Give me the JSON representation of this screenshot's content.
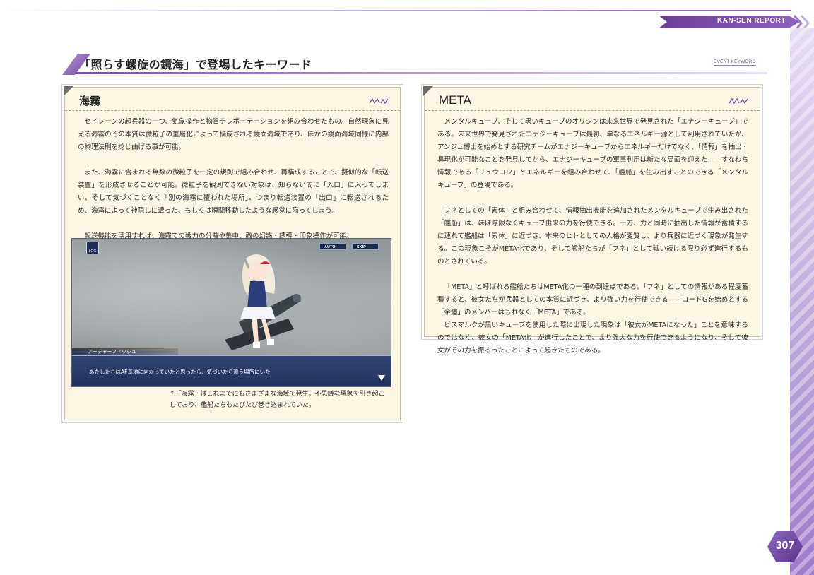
{
  "header": {
    "report_label": "KAN-SEN REPORT"
  },
  "page_title": "「照らす螺旋の鏡海」で登場したキーワード",
  "event_keyword": "EVENT KEYWORD",
  "left_box": {
    "heading": "海霧",
    "paragraphs": [
      "セイレーンの超兵器の一つ、気象操作と物質テレポーテーションを組み合わせたもの。自然現象に見える海霧のその本質は微粒子の重層化によって構成される鏡面海域であり、ほかの鏡面海域同様に内部の物理法則を捻じ曲げる事が可能。",
      "また、海霧に含まれる無数の微粒子を一定の規則で組み合わせ、再構成することで、擬似的な「転送装置」を形成させることが可能。微粒子を観測できない対象は、知らない間に「入口」に入ってしまい、そして気づくことなく「別の海霧に覆われた場所」、つまり転送装置の「出口」に転送されるため、海霧によって神隠しに遭った、もしくは瞬間移動したような感覚に陥ってしまう。",
      "転送機能を活用すれば、海霧での戦力の分散や集中、敵の幻惑・誘導・印象操作が可能。"
    ],
    "game": {
      "log_label": "LOG",
      "auto_label": "AUTO",
      "skip_label": "SKIP",
      "speaker": "アーチャーフィッシュ",
      "line": "あたしたちはAF基地に向かっていたと思ったら、気づいたら違う場所にいた",
      "next_label": "NEXT"
    },
    "caption": "↑「海霧」はこれまでにもさまざまな海域で発生。不思議な現象を引き起こしており、艦船たちもたびたび巻き込まれていた。"
  },
  "right_box": {
    "heading": "META",
    "paragraphs": [
      "メンタルキューブ、そして黒いキューブのオリジンは未来世界で発見された「エナジーキューブ」である。未来世界で発見されたエナジーキューブは最初、単なるエネルギー源として利用されていたが、アンジュ博士を始めとする研究チームがエナジーキューブからエネルギーだけでなく、「情報」を抽出・具現化が可能なことを発見してから、エナジーキューブの軍事利用は新たな局面を迎えた——すなわち情報である「リュウコツ」とエネルギーを組み合わせて、「艦船」を生み出すことのできる「メンタルキューブ」の登場である。",
      "フネとしての「素体」と組み合わせて、情報抽出機能を追加されたメンタルキューブで生み出された「艦船」は、ほぼ際限なくキューブ由来の力を行使できる。一方、力と同時に抽出した情報が蓄積するに連れて艦船は「素体」に近づき、本来のヒトとしての人格が変質し、より兵器に近づく現象が発生する。この現象こそがMETA化であり、そして艦船たちが「フネ」として戦い続ける限り必ず進行するものとされている。",
      "「META」と呼ばれる艦船たちはMETA化の一種の到達点である。「フネ」としての情報がある程度蓄積すると、彼女たちが兵器としての本質に近づき、より強い力を行使できる——コードGを始めとする「余燼」のメンバーはもれなく「META」である。",
      "ビスマルクが黒いキューブを使用した際に出現した現象は「彼女がMETAになった」ことを意味するのではなく、彼女の「META化」が進行したことで、より強大な力を行使できるようになり、そして彼女がその力を振るったことによって起きたものである。"
    ]
  },
  "page_number": "307",
  "colors": {
    "accent": "#7a4fb0",
    "box_bg": "#fbf7e4",
    "dialog": "#283e6e"
  }
}
